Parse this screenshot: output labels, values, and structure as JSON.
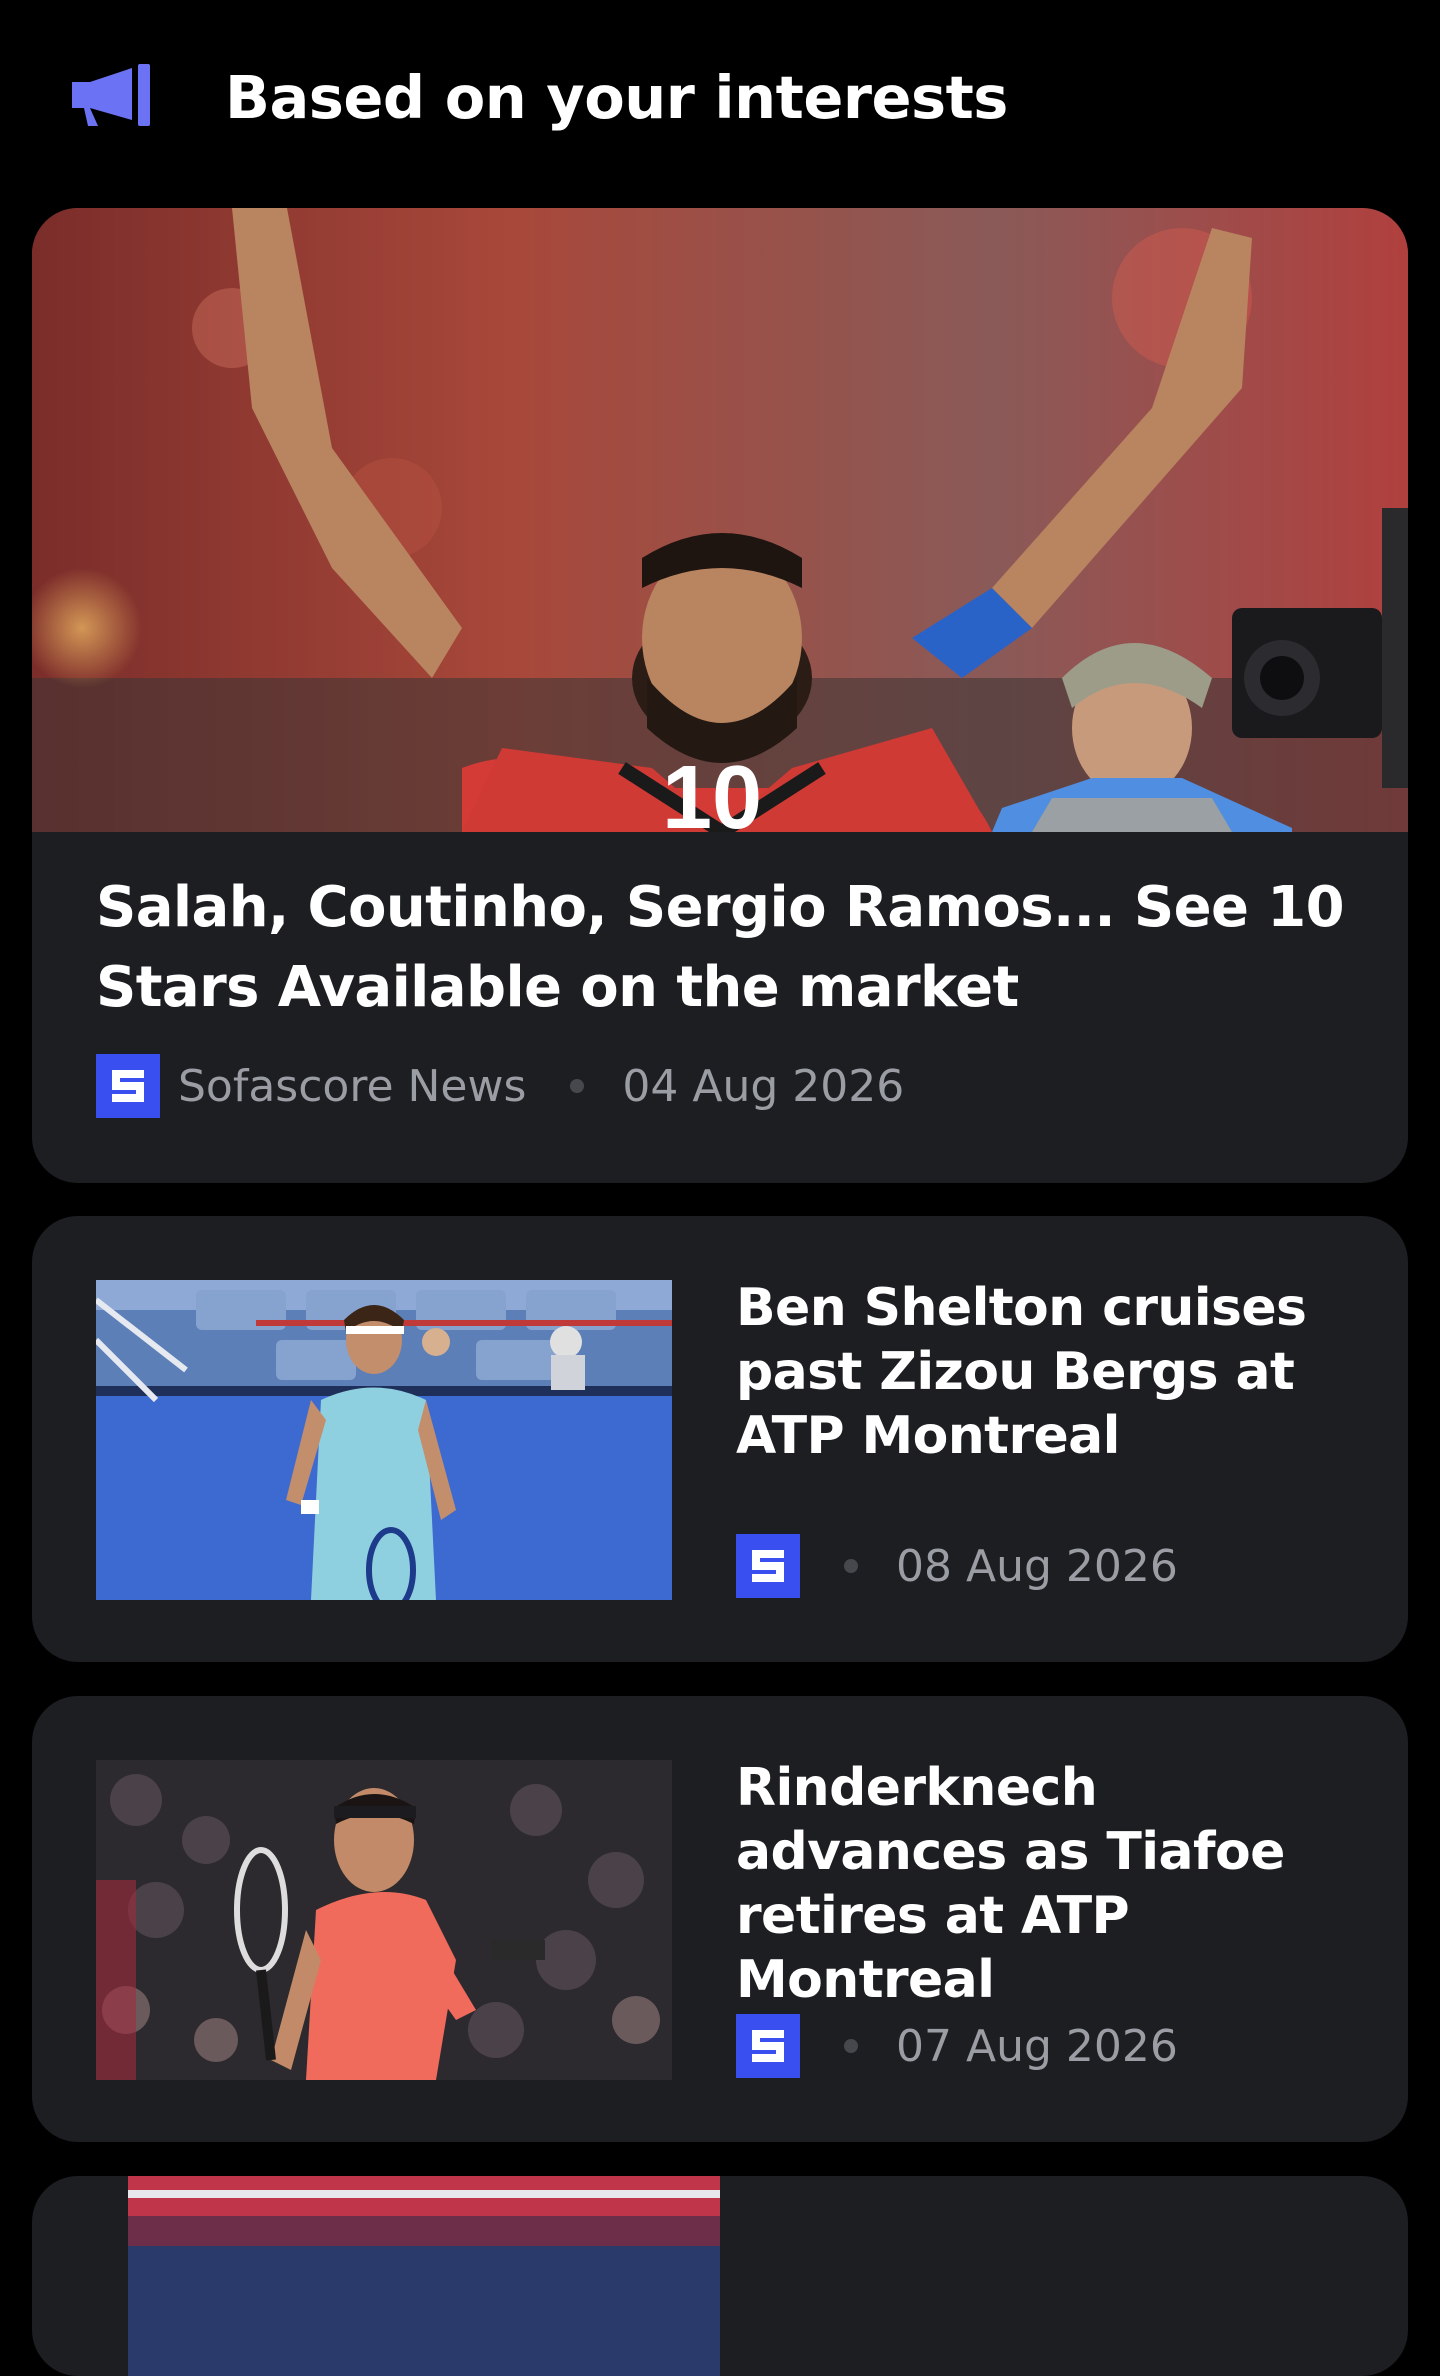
{
  "section": {
    "title": "Based on your interests",
    "icon": "megaphone-icon",
    "accent_color": "#6b73f4"
  },
  "featured_article": {
    "image": "player-celebrating-photo",
    "title": "Salah, Coutinho, Sergio Ramos... See 10 Stars Available on the market",
    "source": "Sofascore News",
    "source_logo": "sofascore-logo-icon",
    "date": "04 Aug 2026"
  },
  "articles": [
    {
      "image": "tennis-player-photo",
      "title": "Ben Shelton cruises past Zizou Bergs at ATP Montreal",
      "source_logo": "sofascore-logo-icon",
      "date": "08 Aug 2026"
    },
    {
      "image": "tennis-player-photo",
      "title": "Rinderknech advances as Tiafoe retires at ATP Montreal",
      "source_logo": "sofascore-logo-icon",
      "date": "07 Aug 2026"
    }
  ],
  "colors": {
    "background": "#000000",
    "card": "#1c1e22",
    "logo": "#3a4ff0",
    "muted_text": "#9a9da3"
  }
}
